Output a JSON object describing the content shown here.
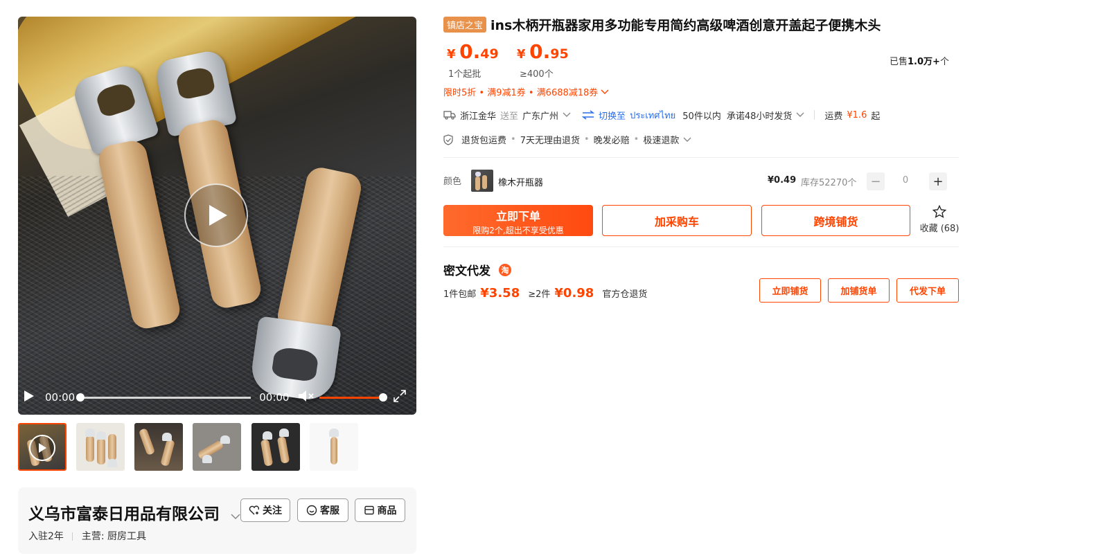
{
  "video": {
    "current_time": "00:00",
    "duration": "00:00"
  },
  "thumbnails": [
    "video-thumb",
    "product-photo",
    "product-photo",
    "product-photo",
    "product-photo",
    "product-photo"
  ],
  "shop": {
    "name": "义乌市富泰日用品有限公司",
    "years": "入驻2年",
    "main_label": "主营:",
    "main_value": "厨房工具",
    "follow_label": "关注",
    "service_label": "客服",
    "products_label": "商品"
  },
  "product": {
    "badge": "镇店之宝",
    "title": "ins木柄开瓶器家用多功能专用简约高级啤酒创意开盖起子便携木头",
    "currency": "¥",
    "price1_int": "0.",
    "price1_dec": "49",
    "price1_note": "1个起批",
    "price2_int": "0.",
    "price2_dec": "95",
    "price2_note": "≥400个",
    "sold_prefix": "已售",
    "sold_value": "1.0万+",
    "sold_suffix": "个",
    "promo": "限时5折 • 满9减1券 • 满6688减18券"
  },
  "shipping": {
    "from": "浙江金华",
    "to_label": "送至",
    "to": "广东广州",
    "switch_label": "切换至",
    "switch_country": "ประเทศไทย",
    "within": "50件以内",
    "promise": "承诺48小时发货",
    "fee_label": "运费",
    "fee_value": "¥1.6",
    "fee_suffix": "起"
  },
  "services": [
    "退货包运费",
    "7天无理由退货",
    "晚发必赔",
    "极速退款"
  ],
  "sku": {
    "label": "颜色",
    "name": "橡木开瓶器",
    "price": "¥0.49",
    "stock": "库存52270个",
    "qty": "0",
    "minus": "−",
    "plus": "+"
  },
  "actions": {
    "order_line1": "立即下单",
    "order_line2": "限购2个,超出不享受优惠",
    "add_cart": "加采购车",
    "cross_border": "跨境铺货",
    "fav_label": "收藏 (68)"
  },
  "dropship": {
    "title": "密文代发",
    "badge": "淘",
    "tier1_label": "1件包邮",
    "tier1_price": "¥3.58",
    "tier2_label": "≥2件",
    "tier2_price": "¥0.98",
    "note": "官方仓退货",
    "btn_list": "立即铺货",
    "btn_add": "加铺货单",
    "btn_order": "代发下单"
  },
  "colors": {
    "accent": "#ff4400",
    "link_blue": "#2a6ee8",
    "badge_orange": "#e8914a"
  }
}
